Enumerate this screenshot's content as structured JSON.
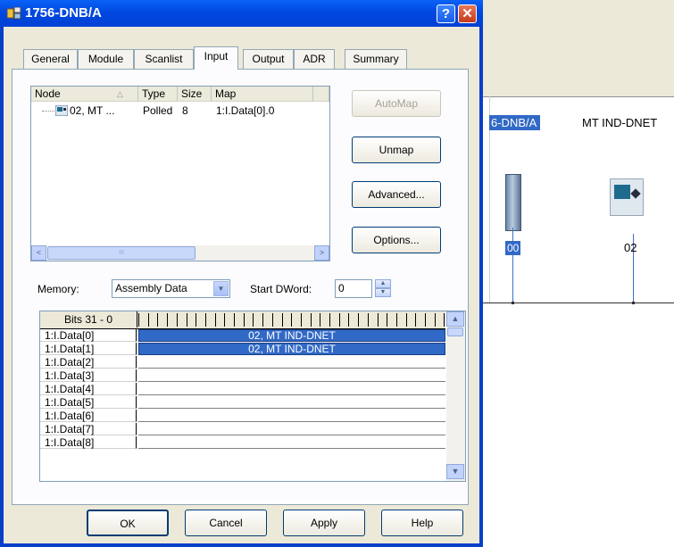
{
  "dialog": {
    "title": "1756-DNB/A",
    "help_glyph": "?",
    "close_glyph": "✕"
  },
  "tabs": [
    {
      "label": "General"
    },
    {
      "label": "Module"
    },
    {
      "label": "Scanlist"
    },
    {
      "label": "Input",
      "active": true
    },
    {
      "label": "Output"
    },
    {
      "label": "ADR"
    },
    {
      "label": "Summary"
    }
  ],
  "node_list": {
    "columns": [
      "Node",
      "Type",
      "Size",
      "Map"
    ],
    "sort_glyph": "△",
    "rows": [
      {
        "node": "02, MT ...",
        "type": "Polled",
        "size": "8",
        "map": "1:I.Data[0].0"
      }
    ],
    "scroll_left": "<",
    "scroll_right": ">",
    "thumb_grip": "III"
  },
  "side_buttons": {
    "automap": "AutoMap",
    "unmap": "Unmap",
    "advanced": "Advanced...",
    "options": "Options..."
  },
  "memory": {
    "label": "Memory:",
    "value": "Assembly Data",
    "dropdown_glyph": "▼",
    "start_label": "Start DWord:",
    "start_value": "0",
    "spin_up": "▲",
    "spin_down": "▼"
  },
  "bit_grid": {
    "header": "Bits 31 - 0",
    "rows": [
      {
        "label": "1:I.Data[0]",
        "map": "02, MT IND-DNET"
      },
      {
        "label": "1:I.Data[1]",
        "map": "02, MT IND-DNET"
      },
      {
        "label": "1:I.Data[2]",
        "map": ""
      },
      {
        "label": "1:I.Data[3]",
        "map": ""
      },
      {
        "label": "1:I.Data[4]",
        "map": ""
      },
      {
        "label": "1:I.Data[5]",
        "map": ""
      },
      {
        "label": "1:I.Data[6]",
        "map": ""
      },
      {
        "label": "1:I.Data[7]",
        "map": ""
      },
      {
        "label": "1:I.Data[8]",
        "map": ""
      }
    ],
    "scroll_up": "▲",
    "scroll_down": "▼"
  },
  "bottom_buttons": {
    "ok": "OK",
    "cancel": "Cancel",
    "apply": "Apply",
    "help": "Help"
  },
  "background": {
    "selected_label": "6-DNB/A",
    "device_label": "MT IND-DNET",
    "node_00": "00",
    "node_02": "02"
  },
  "colors": {
    "title_bar": "#0a4fe4",
    "selection": "#3169c6",
    "dialog_face": "#ece9d8"
  }
}
